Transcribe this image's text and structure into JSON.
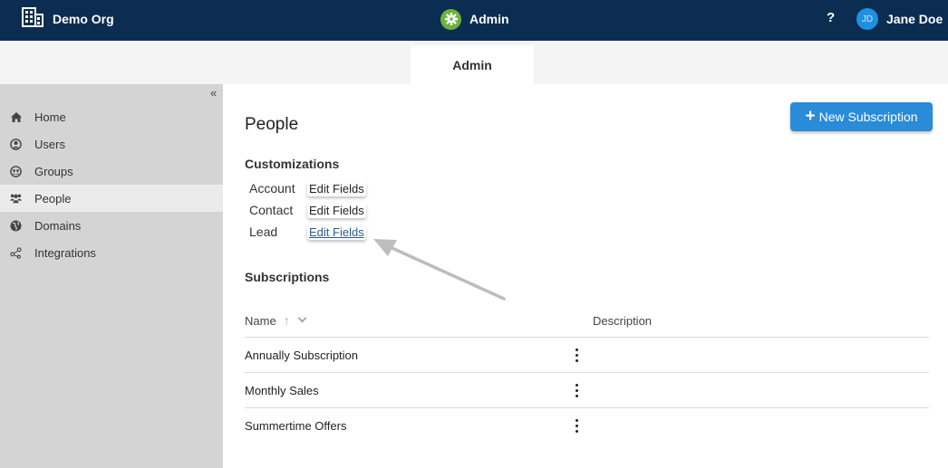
{
  "header": {
    "org_name": "Demo Org",
    "app_title": "Admin",
    "help_label": "?",
    "user_initials": "JD",
    "user_name": "Jane Doe"
  },
  "tabs": [
    {
      "label": "Admin",
      "active": true
    }
  ],
  "sidebar": {
    "collapse_label": "«",
    "items": [
      {
        "label": "Home",
        "icon": "home-icon"
      },
      {
        "label": "Users",
        "icon": "user-circle-icon"
      },
      {
        "label": "Groups",
        "icon": "group-circle-icon"
      },
      {
        "label": "People",
        "icon": "people-icon",
        "active": true
      },
      {
        "label": "Domains",
        "icon": "globe-icon"
      },
      {
        "label": "Integrations",
        "icon": "share-nodes-icon"
      }
    ]
  },
  "main": {
    "title": "People",
    "new_button_label": "New Subscription",
    "customizations": {
      "heading": "Customizations",
      "rows": [
        {
          "label": "Account",
          "link": "Edit Fields"
        },
        {
          "label": "Contact",
          "link": "Edit Fields"
        },
        {
          "label": "Lead",
          "link": "Edit Fields"
        }
      ]
    },
    "subscriptions": {
      "heading": "Subscriptions",
      "columns": [
        "Name",
        "Description"
      ],
      "rows": [
        {
          "name": "Annually Subscription",
          "description": ""
        },
        {
          "name": "Monthly Sales",
          "description": ""
        },
        {
          "name": "Summertime Offers",
          "description": ""
        }
      ]
    }
  },
  "colors": {
    "topbar": "#0b2d52",
    "accent": "#2a8bd8",
    "gear_badge": "#6db33f",
    "sidebar": "#d4d4d4"
  }
}
